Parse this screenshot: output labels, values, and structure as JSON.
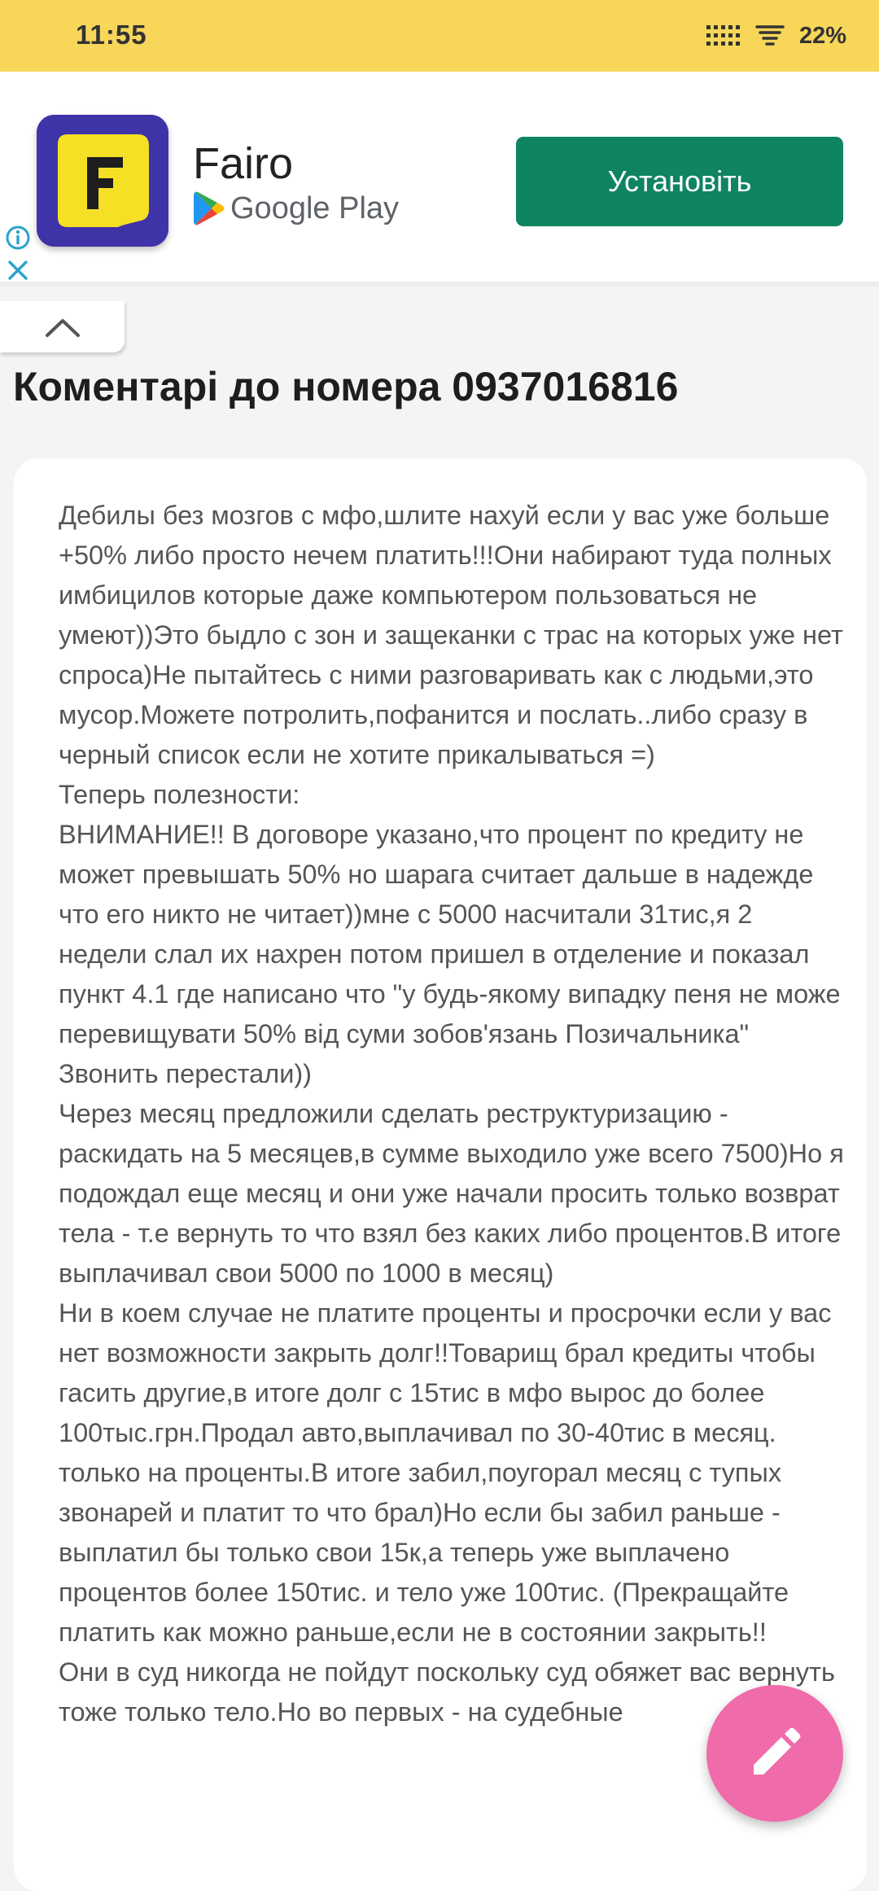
{
  "status_bar": {
    "time": "11:55",
    "battery": "22%"
  },
  "ad": {
    "app_name": "Fairo",
    "store_label": "Google Play",
    "install_label": "Установіть",
    "app_icon_letter": "F",
    "icon_colors": {
      "background": "#3f33a8",
      "tile": "#f5e025",
      "letter": "#1e1e1e"
    },
    "install_color": "#0f8461"
  },
  "page": {
    "title": "Коментарі до номера 0937016816"
  },
  "comment": {
    "paragraphs": [
      "Дебилы без мозгов с мфо,шлите нахуй если у вас уже больше +50% либо просто нечем платить!!!Они набирают туда полных имбицилов которые даже компьютером пользоваться не умеют))Это быдло с зон и защеканки с трас на которых уже нет спроса)Не пытайтесь с ними разговаривать как с людьми,это мусор.Можете потролить,пофанится и послать..либо сразу в черный список если не хотите прикалываться =)",
      "Теперь полезности:",
      "ВНИМАНИЕ!! В договоре указано,что процент по кредиту не может превышать 50% но шарага считает дальше в надежде что его никто не читает))мне с 5000 насчитали 31тис,я 2 недели слал их нахрен потом пришел в отделение и показал пункт 4.1 где написано что \"у будь-якому випадку пеня не може перевищувати 50% від суми зобов'язань Позичальника\" Звонить перестали))",
      "Через месяц предложили сделать реструктуризацию - раскидать на 5 месяцев,в сумме выходило уже всего 7500)Но я подождал еще месяц и они уже начали просить только возврат тела - т.е вернуть то что взял без каких либо процентов.В итоге выплачивал свои 5000 по 1000 в месяц)",
      "Ни в коем случае не платите проценты и просрочки если у вас нет возможности закрыть долг!!Товарищ брал кредиты чтобы гасить другие,в итоге долг с 15тис в мфо вырос до более 100тыс.грн.Продал авто,выплачивал по 30-40тис в месяц. только на проценты.В итоге забил,поугорал месяц с тупых звонарей и платит то что брал)Но если бы забил раньше - выплатил бы только свои 15к,а теперь уже выплачено процентов более 150тис. и тело уже 100тис. (Прекращайте платить как можно раньше,если не в состоянии закрыть!!",
      "Они в суд никогда не пойдут поскольку суд обяжет вас вернуть тоже только тело.Но во первых - на судебные"
    ]
  },
  "colors": {
    "status_bar": "#f8d65a",
    "fab": "#f06ba9",
    "page_background": "#f4f4f4",
    "card_background": "#ffffff"
  },
  "icons": {
    "signal": "signal-grid-icon",
    "wifi": "wifi-icon",
    "ad_info": "info-icon",
    "ad_close": "close-icon",
    "collapse": "chevron-up-icon",
    "fab": "pencil-icon",
    "store": "google-play-icon"
  }
}
